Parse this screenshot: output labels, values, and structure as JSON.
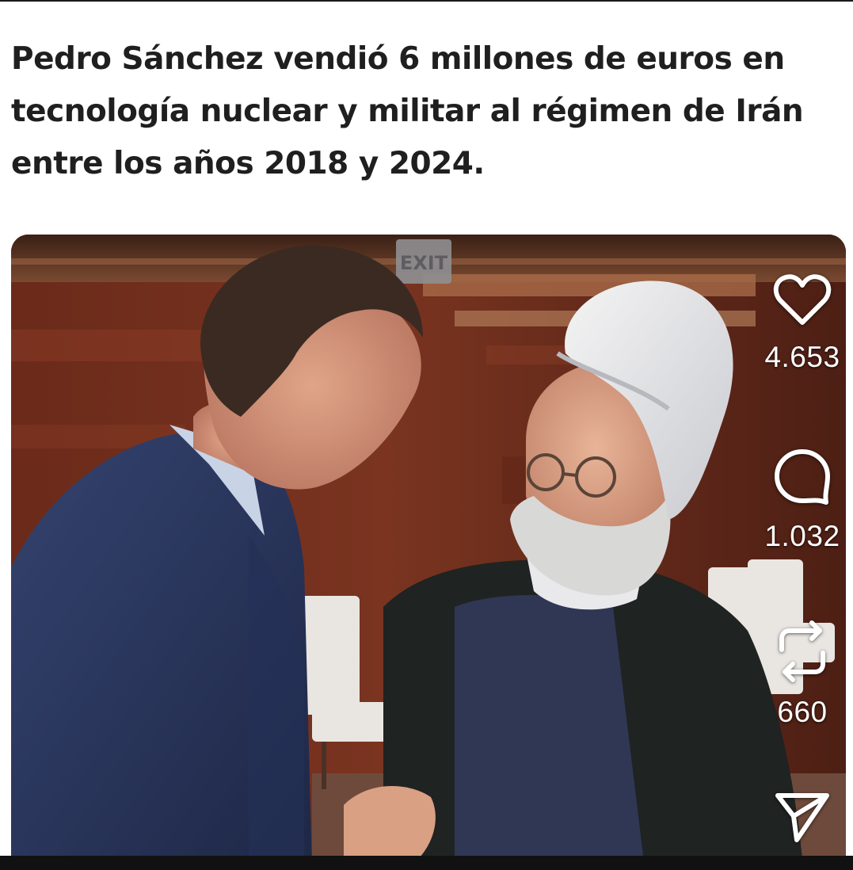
{
  "post": {
    "headline": "Pedro Sánchez vendió 6 millones de euros en tecnología nuclear y militar al régimen de Irán entre los años 2018 y 2024.",
    "sign_text": "EXIT"
  },
  "actions": {
    "like": {
      "icon": "heart-icon",
      "count": "4.653"
    },
    "comment": {
      "icon": "comment-bubble-icon",
      "count": "1.032"
    },
    "repost": {
      "icon": "repost-icon",
      "count": "660"
    },
    "share": {
      "icon": "send-icon"
    }
  },
  "colors": {
    "overlay_text": "#ffffff",
    "headline_text": "#1f1f1f"
  }
}
